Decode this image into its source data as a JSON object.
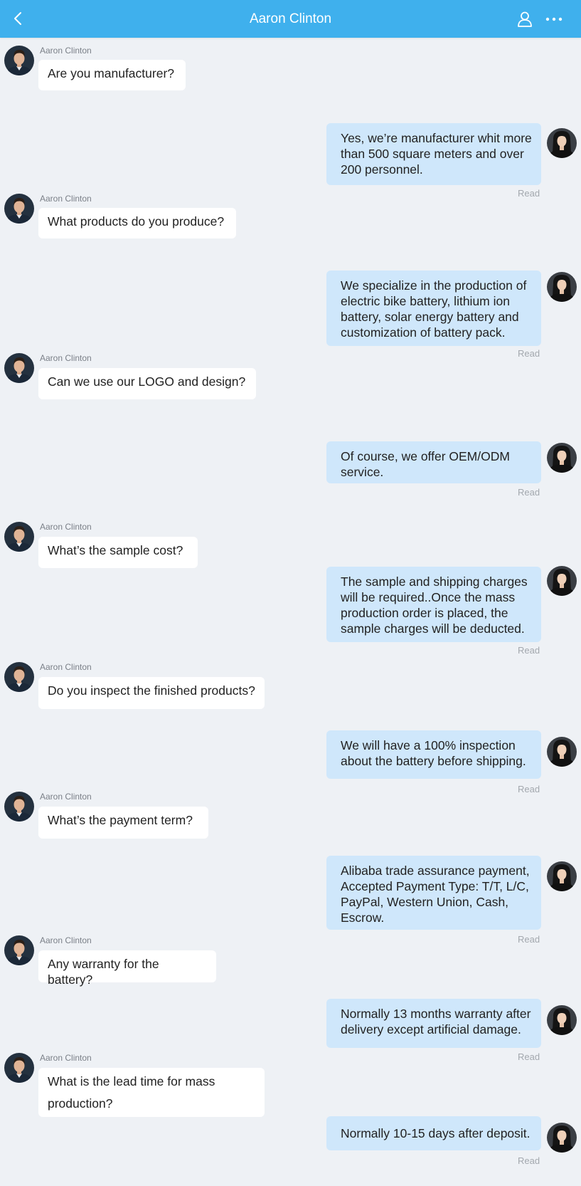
{
  "header": {
    "title": "Aaron Clinton",
    "background": "#3fb0ed",
    "icons": [
      "back-chevron-icon",
      "user-profile-icon",
      "more-dots-icon"
    ]
  },
  "contact_name": "Aaron Clinton",
  "read_label": "Read",
  "colors": {
    "page_bg": "#eef1f5",
    "incoming_bubble": "#ffffff",
    "outgoing_bubble": "#cfe7fb"
  },
  "messages": [
    {
      "from": "contact",
      "text": "Are you manufacturer?"
    },
    {
      "from": "me",
      "text": "Yes, we’re manufacturer whit more than 500 square meters and over 200 personnel.",
      "status": "Read"
    },
    {
      "from": "contact",
      "text": "What products do you produce?"
    },
    {
      "from": "me",
      "text": "We specialize in the production of electric bike battery, lithium ion battery, solar energy battery and customization of battery pack.",
      "status": "Read"
    },
    {
      "from": "contact",
      "text": "Can we use our LOGO and design?"
    },
    {
      "from": "me",
      "text": "Of course, we offer OEM/ODM service.",
      "status": "Read"
    },
    {
      "from": "contact",
      "text": "What’s the sample cost?"
    },
    {
      "from": "me",
      "text": "The sample and shipping charges will be required..Once the mass production order is placed, the sample charges will be deducted.",
      "status": "Read"
    },
    {
      "from": "contact",
      "text": "Do you inspect the finished products?"
    },
    {
      "from": "me",
      "text": "We will have a 100% inspection about the battery before shipping.",
      "status": "Read"
    },
    {
      "from": "contact",
      "text": "What’s the payment term?"
    },
    {
      "from": "me",
      "text": "Alibaba trade assurance payment, Accepted Payment Type: T/T, L/C, PayPal, Western Union, Cash, Escrow.",
      "status": "Read"
    },
    {
      "from": "contact",
      "text": "Any warranty for the battery?"
    },
    {
      "from": "me",
      "text": "Normally 13 months warranty after delivery except artificial damage.",
      "status": "Read"
    },
    {
      "from": "contact",
      "text": "What is the lead time for mass production?"
    },
    {
      "from": "me",
      "text": "Normally 10-15 days after deposit.",
      "status": "Read"
    }
  ]
}
